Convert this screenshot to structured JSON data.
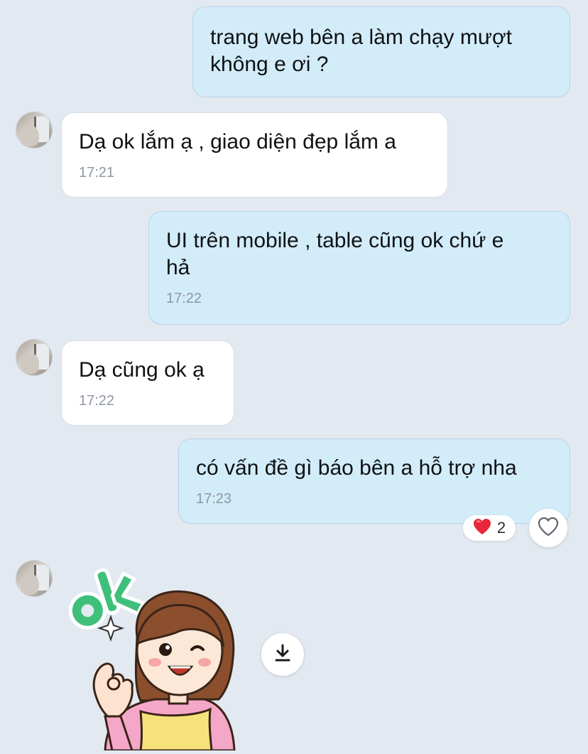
{
  "conversation": {
    "messages": [
      {
        "id": "m1",
        "direction": "outgoing",
        "text": "trang web bên a làm chạy mượt\nkhông e ơi ?",
        "time": ""
      },
      {
        "id": "m2",
        "direction": "incoming",
        "text": "Dạ ok lắm ạ , giao diện đẹp lắm a",
        "time": "17:21"
      },
      {
        "id": "m3",
        "direction": "outgoing",
        "text": "UI trên mobile , table cũng ok chứ e\nhả",
        "time": "17:22"
      },
      {
        "id": "m4",
        "direction": "incoming",
        "text": "Dạ cũng ok ạ",
        "time": "17:22"
      },
      {
        "id": "m5",
        "direction": "outgoing",
        "text": "có vấn đề gì báo bên a hỗ trợ nha",
        "time": "17:23"
      }
    ],
    "reaction": {
      "icon": "heart-icon",
      "count": "2"
    },
    "like_icon": "heart-outline-icon",
    "sticker": {
      "type": "ok-girl-sticker",
      "lettering": "ok"
    },
    "download_icon": "download-icon"
  },
  "colors": {
    "background": "#e2e9f1",
    "outgoing_bubble": "#d3ecfa",
    "incoming_bubble": "#ffffff",
    "timestamp": "#8f98a2",
    "reaction_heart": "#e8283a",
    "sticker_ok_green": "#3fc07a"
  }
}
